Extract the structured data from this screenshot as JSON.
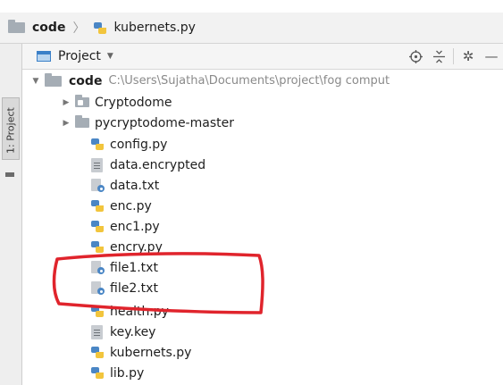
{
  "breadcrumb": {
    "root": "code",
    "file": "kubernets.py"
  },
  "tool_window_tab": {
    "label": "1: Project"
  },
  "project_header": {
    "selector_label": "Project",
    "icons": [
      "target-icon",
      "collapse-all-icon",
      "gear-icon",
      "minimize-icon"
    ]
  },
  "tree": {
    "root": {
      "name": "code",
      "path": "C:\\Users\\Sujatha\\Documents\\project\\fog comput"
    },
    "folders": [
      {
        "name": "Cryptodome"
      },
      {
        "name": "pycryptodome-master"
      }
    ],
    "files": [
      {
        "name": "config.py",
        "type": "py"
      },
      {
        "name": "data.encrypted",
        "type": "data"
      },
      {
        "name": "data.txt",
        "type": "txt"
      },
      {
        "name": "enc.py",
        "type": "py"
      },
      {
        "name": "enc1.py",
        "type": "py"
      },
      {
        "name": "encry.py",
        "type": "py"
      },
      {
        "name": "file1.txt",
        "type": "txt"
      },
      {
        "name": "file2.txt",
        "type": "txt"
      },
      {
        "name": "health.py",
        "type": "py"
      },
      {
        "name": "key.key",
        "type": "data"
      },
      {
        "name": "kubernets.py",
        "type": "py"
      },
      {
        "name": "lib.py",
        "type": "py"
      }
    ]
  },
  "colors": {
    "annotation_red": "#e0242c",
    "folder_gray": "#a5adb5",
    "python_blue": "#4a86c5",
    "python_yellow": "#f2c53d"
  }
}
